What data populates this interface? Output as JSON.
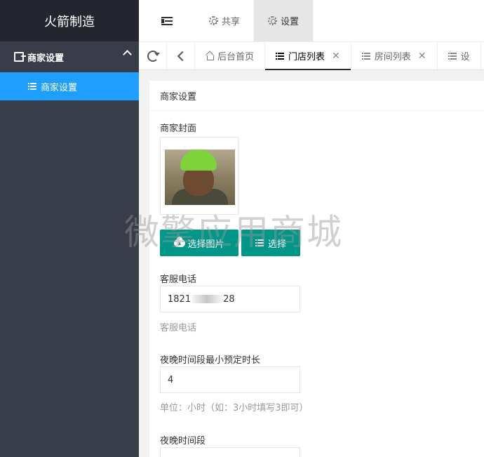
{
  "sidebar": {
    "brand": "火箭制造",
    "group_label": "商家设置",
    "sub_label": "商家设置"
  },
  "header": {
    "menu": [
      {
        "label": "共享"
      },
      {
        "label": "设置"
      }
    ]
  },
  "tabs": [
    {
      "label": "后台首页"
    },
    {
      "label": "门店列表"
    },
    {
      "label": "房间列表"
    },
    {
      "label": "设"
    }
  ],
  "card": {
    "title": "商家设置",
    "cover_label": "商家封面",
    "upload_button": "选择图片",
    "select_button": "选择",
    "phone_label": "客服电话",
    "phone_prefix": "1821",
    "phone_suffix": "28",
    "phone_help": "客服电话",
    "night_min_label": "夜晚时间段最小预定时长",
    "night_min_value": "4",
    "night_min_help": "单位：小时（如：3小时填写3即可）",
    "night_period_label": "夜晚时间段"
  },
  "watermark": "微擎应用商城",
  "colors": {
    "sidebar_bg": "#393d49",
    "active_blue": "#1e9fff",
    "button_teal": "#009688"
  }
}
